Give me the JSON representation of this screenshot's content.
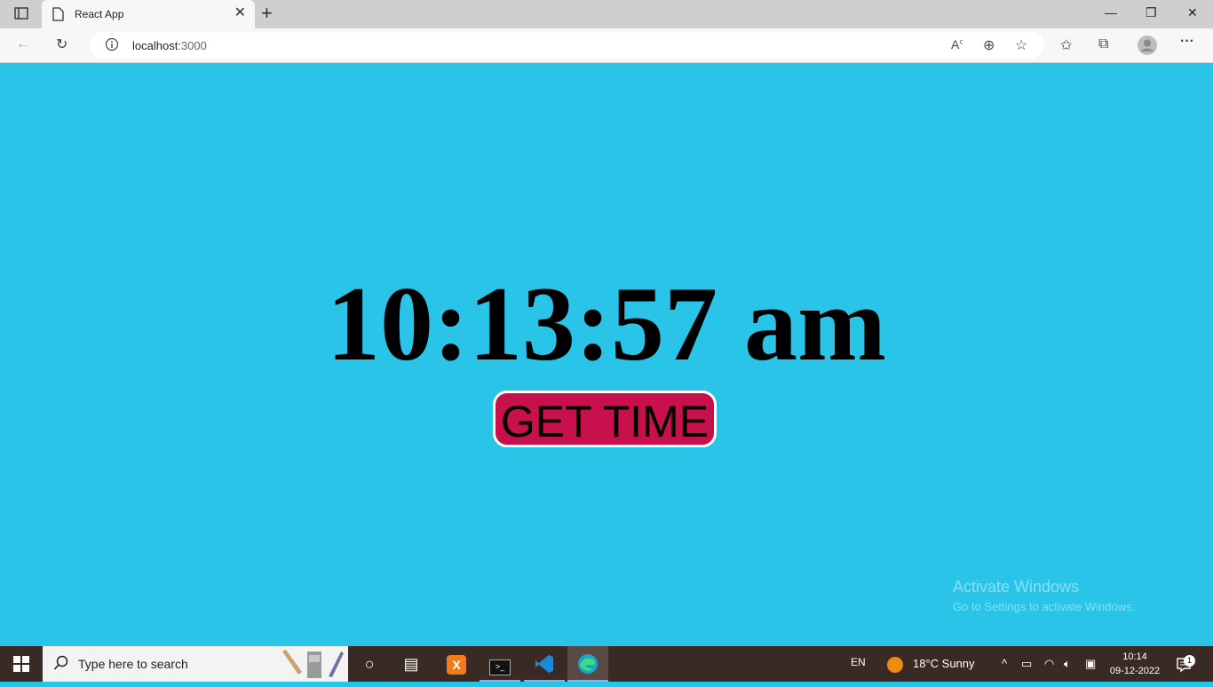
{
  "browser": {
    "tab_title": "React App",
    "url_host": "localhost",
    "url_port": ":3000"
  },
  "app": {
    "time": "10:13:57 am",
    "button_label": "GET TIME"
  },
  "watermark": {
    "line1": "Activate Windows",
    "line2": "Go to Settings to activate Windows."
  },
  "taskbar": {
    "search_placeholder": "Type here to search",
    "language": "EN",
    "weather": "18°C  Sunny",
    "time": "10:14",
    "date": "09-12-2022",
    "notification_count": "1"
  },
  "colors": {
    "page_bg": "#29c4e8",
    "button_bg": "#c8104c",
    "taskbar_bg": "#3a2a26"
  }
}
